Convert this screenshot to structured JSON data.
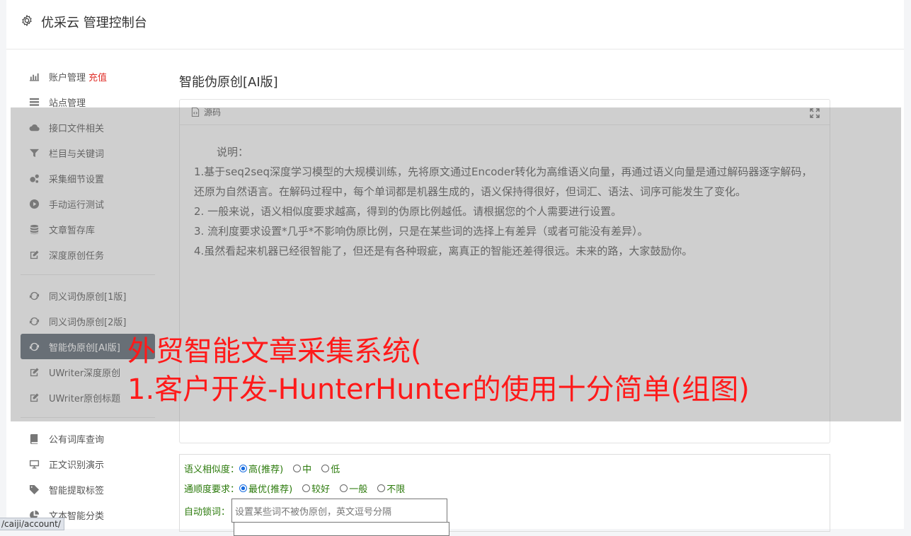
{
  "header": {
    "title": "优采云 管理控制台"
  },
  "sidebar": {
    "group1": [
      {
        "label": "账户管理",
        "extra": "充值",
        "icon": "bar-chart-icon"
      },
      {
        "label": "站点管理",
        "icon": "list-icon"
      },
      {
        "label": "接口文件相关",
        "icon": "cloud-upload-icon"
      },
      {
        "label": "栏目与关键词",
        "icon": "filter-icon"
      },
      {
        "label": "采集细节设置",
        "icon": "gears-icon"
      },
      {
        "label": "手动运行测试",
        "icon": "play-icon"
      },
      {
        "label": "文章暂存库",
        "icon": "database-icon"
      },
      {
        "label": "深度原创任务",
        "icon": "edit-icon"
      }
    ],
    "group2": [
      {
        "label": "同义词伪原创[1版]",
        "icon": "refresh-icon"
      },
      {
        "label": "同义词伪原创[2版]",
        "icon": "refresh-icon"
      },
      {
        "label": "智能伪原创[AI版]",
        "icon": "refresh-icon",
        "active": true
      },
      {
        "label": "UWriter深度原创",
        "icon": "edit-icon"
      },
      {
        "label": "UWriter原创标题",
        "icon": "edit-icon"
      }
    ],
    "group3": [
      {
        "label": "公有词库查询",
        "icon": "book-icon"
      },
      {
        "label": "正文识别演示",
        "icon": "monitor-icon"
      },
      {
        "label": "智能提取标签",
        "icon": "tag-icon"
      },
      {
        "label": "文本智能分类",
        "icon": "pie-chart-icon"
      }
    ]
  },
  "main": {
    "title": "智能伪原创[AI版]",
    "editor": {
      "source_label": "源码",
      "lines": [
        "说明：",
        "1.基于seq2seq深度学习模型的大规模训练，先将原文通过Encoder转化为高维语义向量，再通过语义向量是通过解码器逐字解码，还原为自然语言。在解码过程中，每个单词都是机器生成的，语义保持得很好，但词汇、语法、词序可能发生了变化。",
        "2. 一般来说，语义相似度要求越高，得到的伪原比例越低。请根据您的个人需要进行设置。",
        "3. 流利度要求设置*几乎*不影响伪原比例，只是在某些词的选择上有差异（或者可能没有差异）。",
        "4.虽然看起来机器已经很智能了，但还是有各种瑕疵，离真正的智能还差得很远。未来的路，大家鼓励你。"
      ]
    },
    "form": {
      "similarity": {
        "label": "语义相似度：",
        "options": [
          "高(推荐)",
          "中",
          "低"
        ],
        "selected": "高(推荐)"
      },
      "fluency": {
        "label": "通顺度要求：",
        "options": [
          "最优(推荐)",
          "较好",
          "一般",
          "不限"
        ],
        "selected": "最优(推荐)"
      },
      "lock": {
        "label": "自动锁词：",
        "placeholder": "设置某些词不被伪原创，英文逗号分隔"
      }
    }
  },
  "watermark": {
    "line1": "外贸智能文章采集系统(",
    "line2": "1.客户开发-HunterHunter的使用十分简单(组图)"
  },
  "statusbar": {
    "url": "/caiji/account/"
  }
}
